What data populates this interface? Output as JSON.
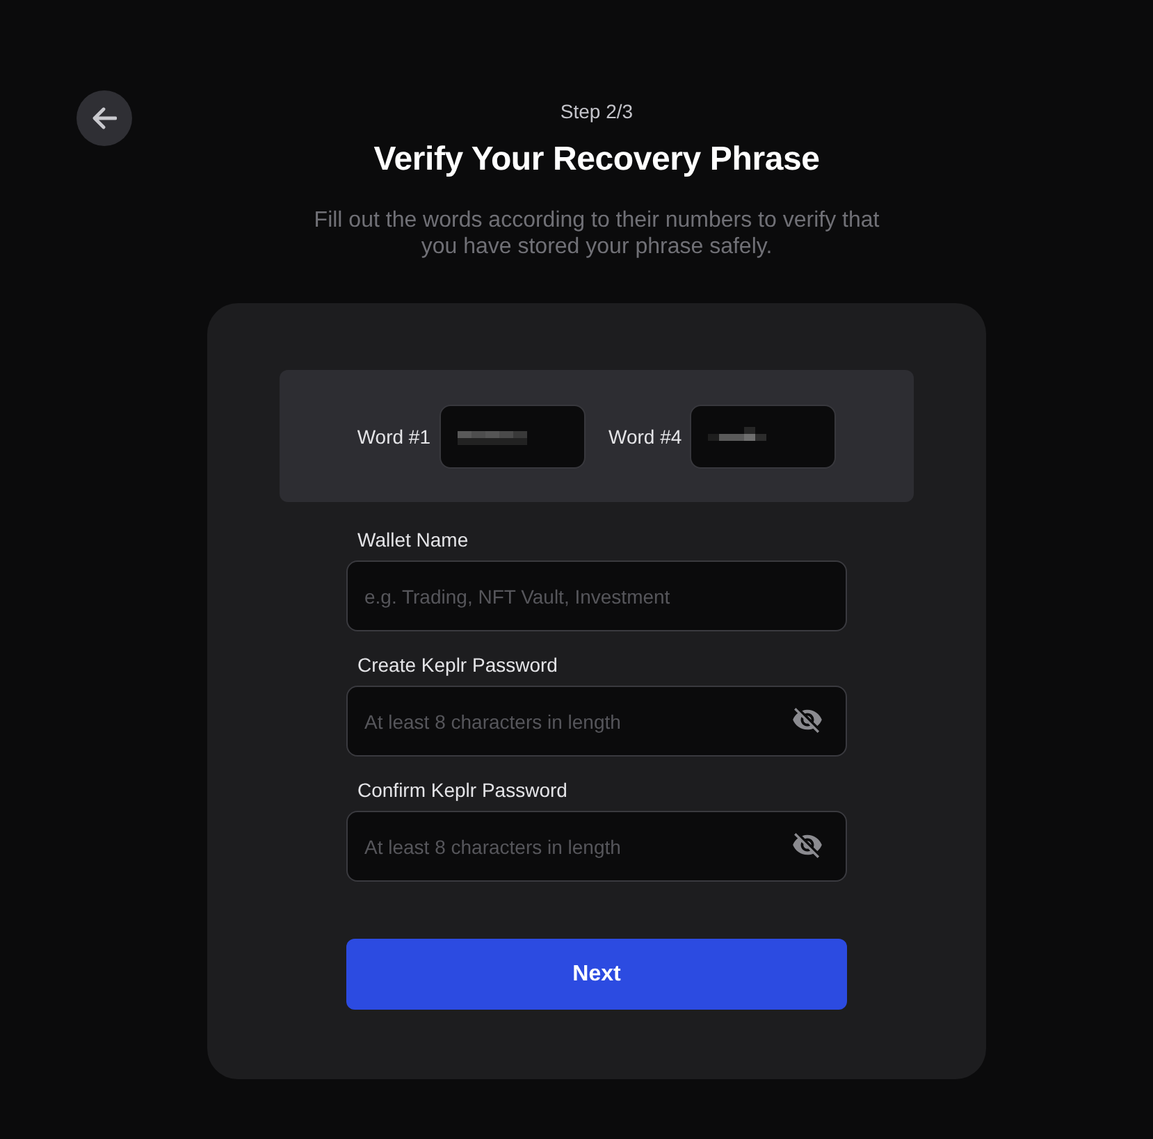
{
  "header": {
    "step": "Step 2/3",
    "title": "Verify Your Recovery Phrase",
    "subtitle": "Fill out the words according to their numbers to verify that you have stored your phrase safely."
  },
  "word_check": [
    {
      "label": "Word #1"
    },
    {
      "label": "Word #4"
    }
  ],
  "fields": [
    {
      "kind": "text",
      "label": "Wallet Name",
      "placeholder": "e.g. Trading, NFT Vault, Investment"
    },
    {
      "kind": "password",
      "label": "Create Keplr Password",
      "placeholder": "At least 8 characters in length"
    },
    {
      "kind": "password",
      "label": "Confirm Keplr Password",
      "placeholder": "At least 8 characters in length"
    }
  ],
  "next_button": {
    "label": "Next"
  }
}
